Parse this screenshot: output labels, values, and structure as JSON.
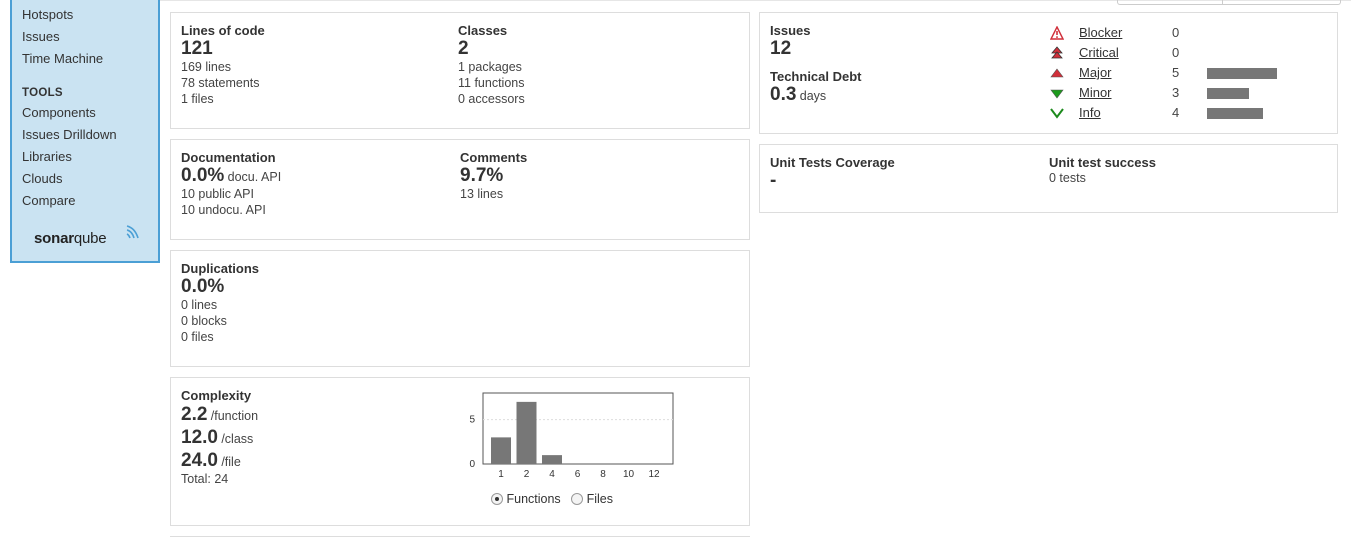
{
  "sidebar": {
    "items": [
      {
        "label": "Hotspots"
      },
      {
        "label": "Issues"
      },
      {
        "label": "Time Machine"
      }
    ],
    "tools_heading": "TOOLS",
    "tools": [
      {
        "label": "Components"
      },
      {
        "label": "Issues Drilldown"
      },
      {
        "label": "Libraries"
      },
      {
        "label": "Clouds"
      },
      {
        "label": "Compare"
      }
    ],
    "logo_text_bold": "sonar",
    "logo_text_thin": "qube"
  },
  "size": {
    "loc_title": "Lines of code",
    "loc_value": "121",
    "loc_lines": "169 lines",
    "loc_statements": "78 statements",
    "loc_files": "1 files",
    "classes_title": "Classes",
    "classes_value": "2",
    "classes_packages": "1 packages",
    "classes_functions": "11 functions",
    "classes_accessors": "0 accessors"
  },
  "documentation": {
    "title": "Documentation",
    "value": "0.0%",
    "value_unit": "docu. API",
    "public_api": "10 public API",
    "undocu_api": "10 undocu. API",
    "comments_title": "Comments",
    "comments_value": "9.7%",
    "comments_lines": "13 lines"
  },
  "duplications": {
    "title": "Duplications",
    "value": "0.0%",
    "lines": "0 lines",
    "blocks": "0 blocks",
    "files": "0 files"
  },
  "complexity": {
    "title": "Complexity",
    "per_function_value": "2.2",
    "per_function_unit": "/function",
    "per_class_value": "12.0",
    "per_class_unit": "/class",
    "per_file_value": "24.0",
    "per_file_unit": "/file",
    "total": "Total: 24",
    "option_functions": "Functions",
    "option_files": "Files",
    "selected_option": "Functions"
  },
  "chart_data": {
    "type": "bar",
    "categories": [
      "1",
      "2",
      "4",
      "6",
      "8",
      "10",
      "12"
    ],
    "values": [
      3,
      7,
      1,
      0,
      0,
      0,
      0
    ],
    "yticks": [
      0,
      5
    ],
    "ylim": [
      0,
      8
    ]
  },
  "issues": {
    "title": "Issues",
    "value": "12",
    "debt_title": "Technical Debt",
    "debt_value": "0.3",
    "debt_unit": "days",
    "severities": [
      {
        "label": "Blocker",
        "count": "0",
        "icon": "blocker-icon",
        "color": "#d02f3a"
      },
      {
        "label": "Critical",
        "count": "0",
        "icon": "critical-icon",
        "color": "#d02f3a"
      },
      {
        "label": "Major",
        "count": "5",
        "icon": "major-icon",
        "color": "#d02f3a"
      },
      {
        "label": "Minor",
        "count": "3",
        "icon": "minor-icon",
        "color": "#008a00"
      },
      {
        "label": "Info",
        "count": "4",
        "icon": "info-icon",
        "color": "#008a00"
      }
    ]
  },
  "tests": {
    "coverage_title": "Unit Tests Coverage",
    "coverage_value": "-",
    "success_title": "Unit test success",
    "success_value": "0 tests"
  },
  "colors": {
    "sidebar_bg": "#cae3f2",
    "sidebar_border": "#4b9fd5",
    "bar": "#777777"
  }
}
